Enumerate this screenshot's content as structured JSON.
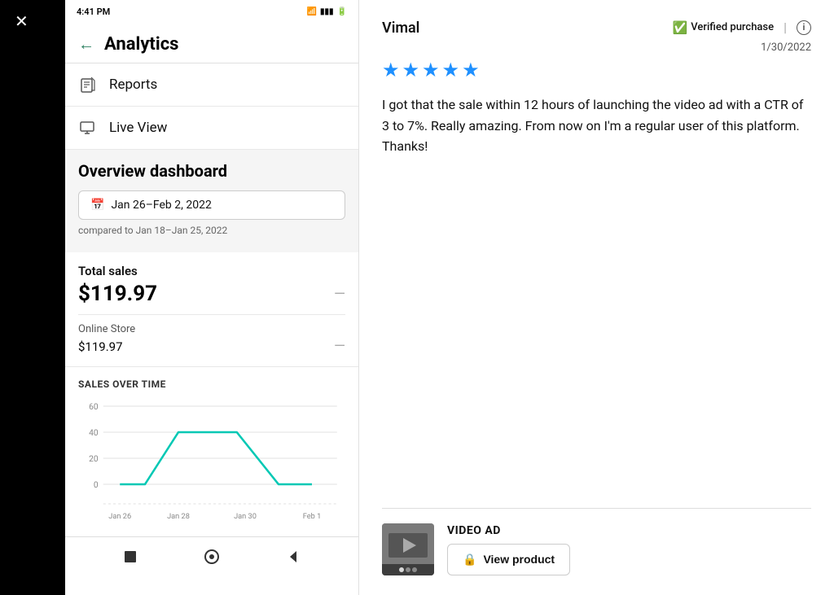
{
  "left_panel": {
    "close_label": "✕",
    "status_bar": {
      "time": "4:41 PM",
      "signal_icon": "●",
      "battery_icon": "🔋"
    },
    "header": {
      "back_arrow": "←",
      "title": "Analytics"
    },
    "nav_items": [
      {
        "id": "reports",
        "label": "Reports",
        "icon": "📄"
      },
      {
        "id": "live-view",
        "label": "Live View",
        "icon": "📺"
      }
    ],
    "overview": {
      "title": "Overview dashboard",
      "date_range": "Jan 26–Feb 2, 2022",
      "compare_text": "compared to Jan 18–Jan 25, 2022"
    },
    "sales": {
      "label": "Total sales",
      "amount": "$119.97",
      "store_label": "Online Store",
      "store_amount": "$119.97"
    },
    "chart": {
      "title": "SALES OVER TIME",
      "y_labels": [
        "60",
        "40",
        "20",
        "0"
      ],
      "x_labels": [
        "Jan 26",
        "Jan 28",
        "Jan 30",
        "Feb 1"
      ]
    },
    "bottom_nav": {
      "items": [
        "stop",
        "circle",
        "back"
      ]
    }
  },
  "right_panel": {
    "reviewer_name": "Vimal",
    "verified_label": "Verified purchase",
    "review_date": "1/30/2022",
    "stars_count": 5,
    "review_text": "I got that the sale within 12 hours of launching the video ad with a CTR of 3 to 7%. Really amazing. From now on I'm a regular user of this platform. Thanks!",
    "product": {
      "type": "VIDEO AD",
      "view_button_label": "View product"
    }
  }
}
